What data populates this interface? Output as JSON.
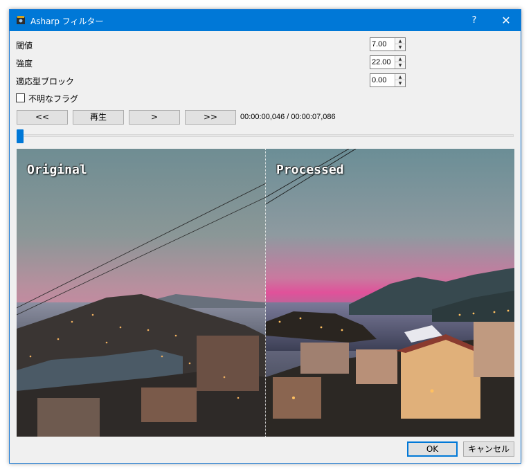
{
  "window": {
    "title": "Asharp フィルター",
    "help_label": "?",
    "close_label": "✕"
  },
  "params": [
    {
      "label": "閾値",
      "value": "7.00"
    },
    {
      "label": "強度",
      "value": "22.00"
    },
    {
      "label": "適応型ブロック",
      "value": "0.00"
    }
  ],
  "checkbox": {
    "label": "不明なフラグ",
    "checked": false
  },
  "nav": {
    "first_label": "<<",
    "play_label": "再生",
    "next_label": ">",
    "last_label": ">>"
  },
  "time": {
    "display": "00:00:00,046 / 00:00:07,086"
  },
  "seek": {
    "position_fraction": 0.0
  },
  "preview": {
    "original_label": "Original",
    "processed_label": "Processed"
  },
  "buttons": {
    "ok_label": "OK",
    "cancel_label": "キャンセル"
  },
  "colors": {
    "accent": "#0078d7",
    "titlebar": "#0078d7",
    "dialog_bg": "#f0f0f0"
  }
}
